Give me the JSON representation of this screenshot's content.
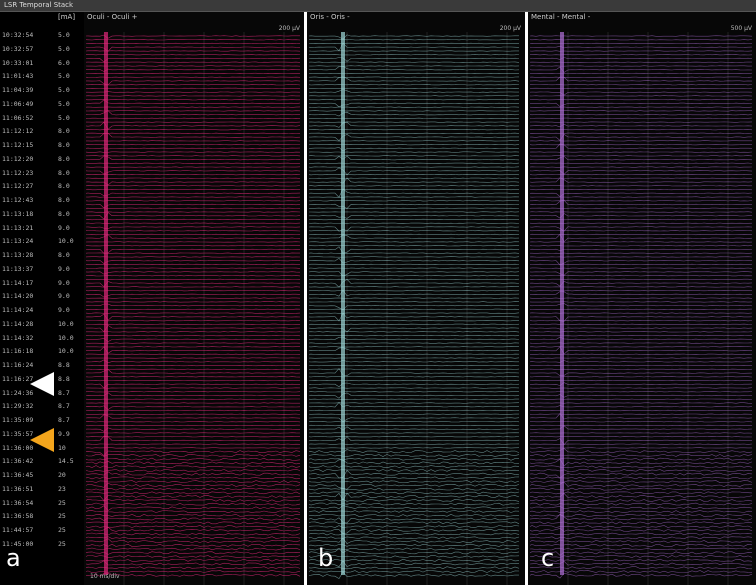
{
  "window": {
    "title": "LSR Temporal Stack"
  },
  "columns": {
    "ma_header": "[mA]"
  },
  "rows": [
    {
      "time": "10:32:54",
      "ma": "5.0"
    },
    {
      "time": "10:32:57",
      "ma": "5.0"
    },
    {
      "time": "10:33:01",
      "ma": "6.0"
    },
    {
      "time": "11:01:43",
      "ma": "5.0"
    },
    {
      "time": "11:04:39",
      "ma": "5.0"
    },
    {
      "time": "11:06:49",
      "ma": "5.0"
    },
    {
      "time": "11:06:52",
      "ma": "5.0"
    },
    {
      "time": "11:12:12",
      "ma": "8.0"
    },
    {
      "time": "11:12:15",
      "ma": "8.0"
    },
    {
      "time": "11:12:20",
      "ma": "8.0"
    },
    {
      "time": "11:12:23",
      "ma": "8.0"
    },
    {
      "time": "11:12:27",
      "ma": "8.0"
    },
    {
      "time": "11:12:43",
      "ma": "8.0"
    },
    {
      "time": "11:13:18",
      "ma": "8.0"
    },
    {
      "time": "11:13:21",
      "ma": "9.0"
    },
    {
      "time": "11:13:24",
      "ma": "10.0"
    },
    {
      "time": "11:13:28",
      "ma": "8.0"
    },
    {
      "time": "11:13:37",
      "ma": "9.0"
    },
    {
      "time": "11:14:17",
      "ma": "9.0"
    },
    {
      "time": "11:14:20",
      "ma": "9.0"
    },
    {
      "time": "11:14:24",
      "ma": "9.0"
    },
    {
      "time": "11:14:28",
      "ma": "10.0"
    },
    {
      "time": "11:14:32",
      "ma": "10.0"
    },
    {
      "time": "11:16:18",
      "ma": "10.0"
    },
    {
      "time": "11:16:24",
      "ma": "8.8"
    },
    {
      "time": "11:16:27",
      "ma": "8.8"
    },
    {
      "time": "11:24:36",
      "ma": "8.7"
    },
    {
      "time": "11:29:32",
      "ma": "8.7"
    },
    {
      "time": "11:35:09",
      "ma": "8.7"
    },
    {
      "time": "11:35:57",
      "ma": "9.9"
    },
    {
      "time": "11:36:00",
      "ma": "10"
    },
    {
      "time": "11:36:42",
      "ma": "14.5"
    },
    {
      "time": "11:36:45",
      "ma": "20"
    },
    {
      "time": "11:36:51",
      "ma": "23"
    },
    {
      "time": "11:36:54",
      "ma": "25"
    },
    {
      "time": "11:36:58",
      "ma": "25"
    },
    {
      "time": "11:44:57",
      "ma": "25"
    },
    {
      "time": "11:45:00",
      "ma": "25"
    }
  ],
  "panels": [
    {
      "header": "Oculi - Oculi +",
      "scale": "200 µV",
      "label": "a",
      "color": "#e0287a"
    },
    {
      "header": "Oris - Oris -",
      "scale": "200 µV",
      "label": "b",
      "color": "#9fd8d8"
    },
    {
      "header": "Mental - Mental -",
      "scale": "500 µV",
      "label": "c",
      "color": "#b070d8"
    }
  ],
  "footer": {
    "timebase": "10 ms/div"
  },
  "markers": {
    "white_color": "#ffffff",
    "orange_color": "#f4a51c"
  }
}
